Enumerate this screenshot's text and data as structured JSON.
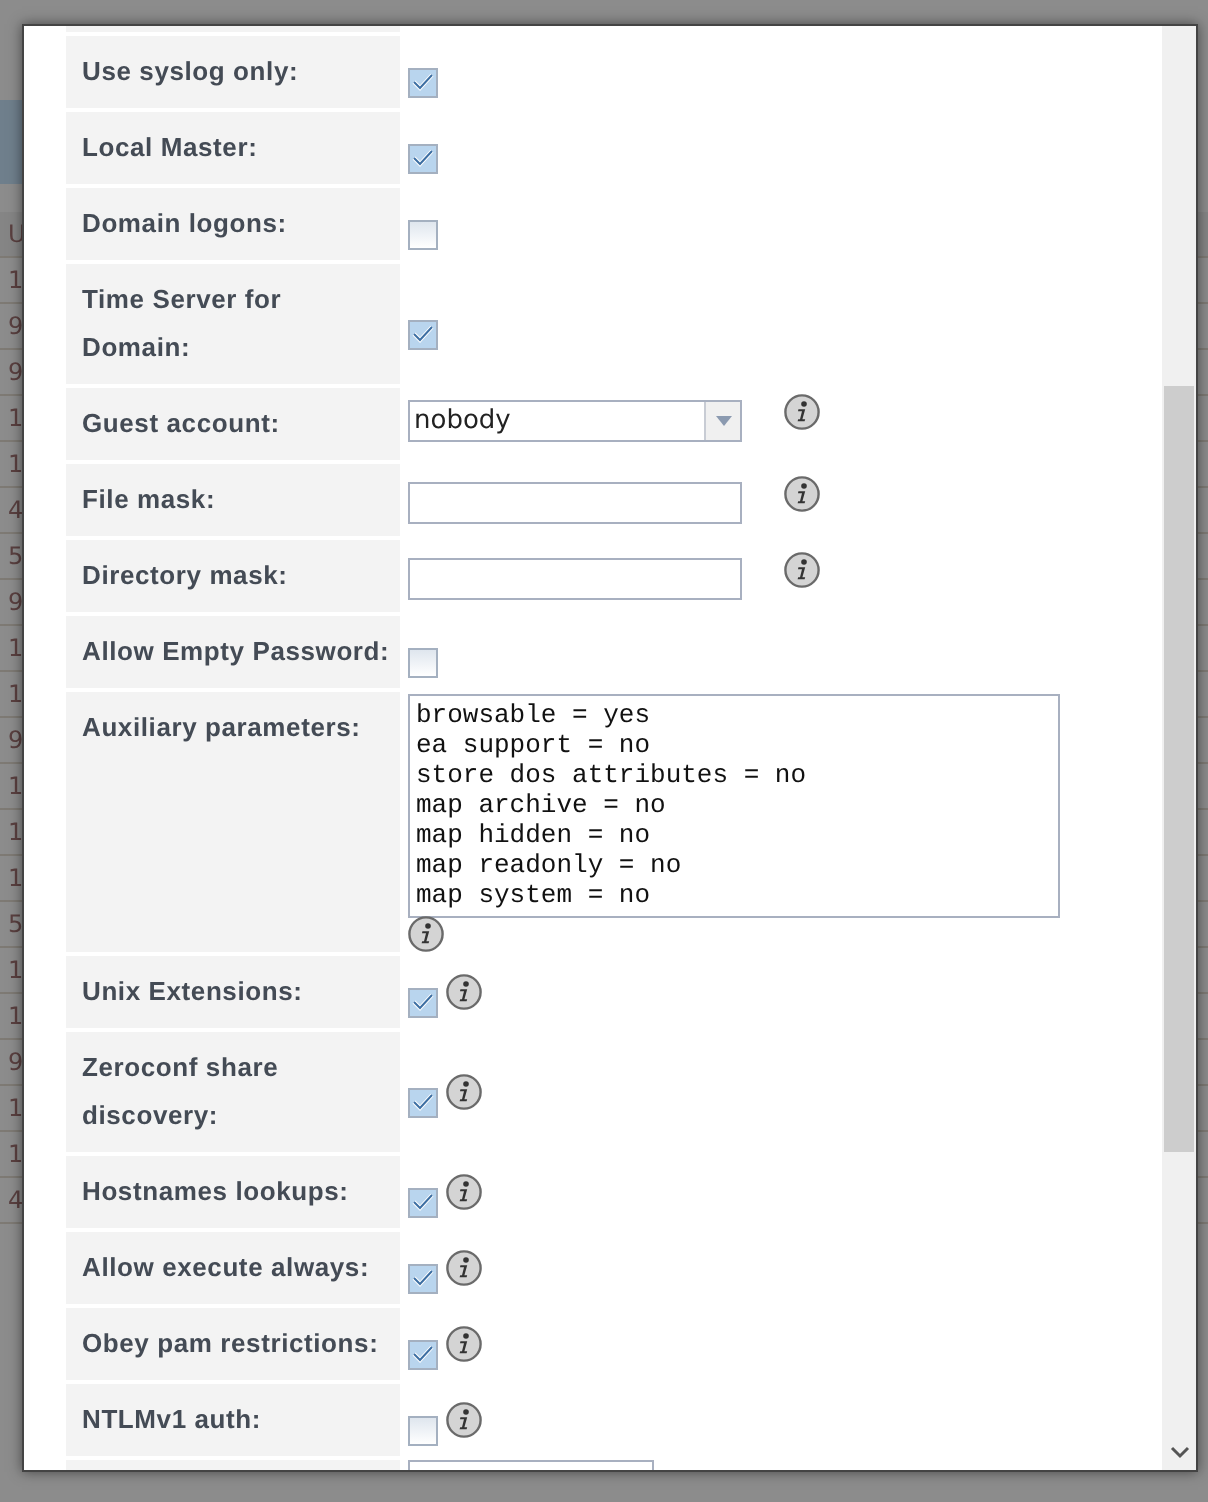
{
  "background": {
    "table_rows": [
      {
        "first": "U"
      },
      {
        "first": "1"
      },
      {
        "first": "9"
      },
      {
        "first": "9"
      },
      {
        "first": "1"
      },
      {
        "first": "1"
      },
      {
        "first": "4"
      },
      {
        "first": "5"
      },
      {
        "first": "9"
      },
      {
        "first": "1"
      },
      {
        "first": "1"
      },
      {
        "first": "9"
      },
      {
        "first": "1"
      },
      {
        "first": "1"
      },
      {
        "first": "1"
      },
      {
        "first": "5"
      },
      {
        "first": "1"
      },
      {
        "first": "1"
      },
      {
        "first": "9"
      },
      {
        "first": "1"
      },
      {
        "first": "1"
      },
      {
        "first": "4"
      }
    ]
  },
  "form": {
    "rows": [
      {
        "kind": "checkbox",
        "label": "Use syslog only:",
        "checked": true,
        "info": false
      },
      {
        "kind": "checkbox",
        "label": "Local Master:",
        "checked": true,
        "info": false
      },
      {
        "kind": "checkbox",
        "label": "Domain logons:",
        "checked": false,
        "info": false
      },
      {
        "kind": "checkbox",
        "label": "Time Server for Domain:",
        "checked": true,
        "info": false
      },
      {
        "kind": "select",
        "label": "Guest account:",
        "value": "nobody",
        "info": true
      },
      {
        "kind": "text",
        "label": "File mask:",
        "info": true
      },
      {
        "kind": "text",
        "label": "Directory mask:",
        "info": true
      },
      {
        "kind": "checkbox",
        "label": "Allow Empty Password:",
        "checked": false,
        "info": false
      },
      {
        "kind": "textarea",
        "label": "Auxiliary parameters:",
        "lines": [
          "browsable = yes",
          "ea support = no",
          "store dos attributes = no",
          "map archive = no",
          "map hidden = no",
          "map readonly = no",
          "map system = no"
        ],
        "info": true
      },
      {
        "kind": "checkbox",
        "label": "Unix Extensions:",
        "checked": true,
        "info": true
      },
      {
        "kind": "checkbox",
        "label": "Zeroconf share discovery:",
        "checked": true,
        "info": true
      },
      {
        "kind": "checkbox",
        "label": "Hostnames lookups:",
        "checked": true,
        "info": true
      },
      {
        "kind": "checkbox",
        "label": "Allow execute always:",
        "checked": true,
        "info": true
      },
      {
        "kind": "checkbox",
        "label": "Obey pam restrictions:",
        "checked": true,
        "info": true
      },
      {
        "kind": "checkbox",
        "label": "NTLMv1 auth:",
        "checked": false,
        "info": true
      }
    ]
  }
}
